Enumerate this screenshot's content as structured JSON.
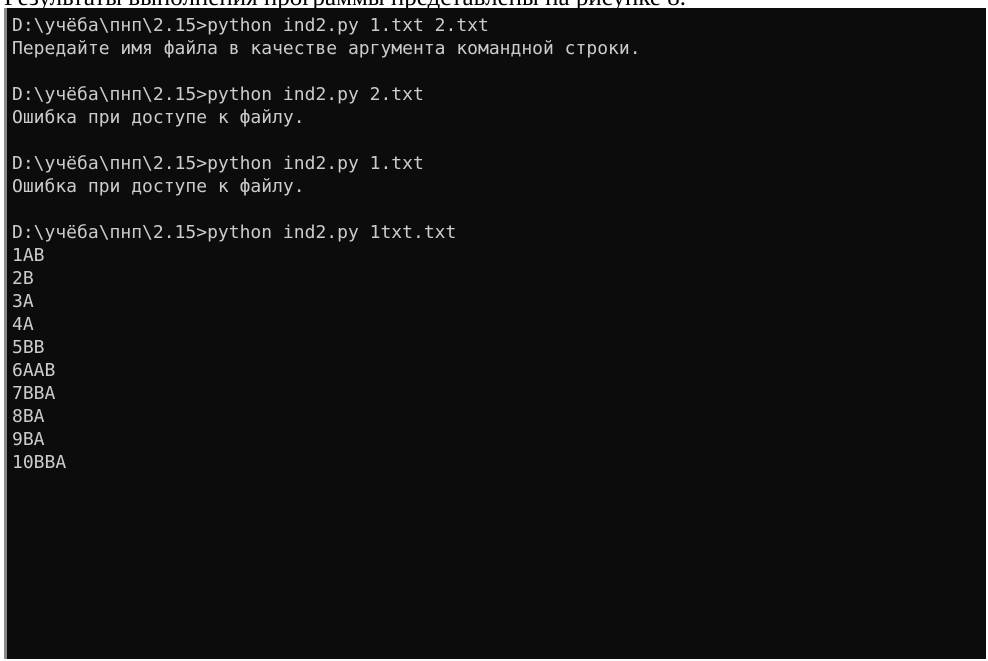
{
  "document": {
    "fragment_text": "Результаты выполнения программы представлены на рисунке 8."
  },
  "terminal": {
    "prompt": "D:\\учёба\\пнп\\2.15>",
    "session": [
      {
        "command": "python ind2.py 1.txt 2.txt",
        "output": [
          "Передайте имя файла в качестве аргумента командной строки."
        ]
      },
      {
        "command": "python ind2.py 2.txt",
        "output": [
          "Ошибка при доступе к файлу."
        ]
      },
      {
        "command": "python ind2.py 1.txt",
        "output": [
          "Ошибка при доступе к файлу."
        ]
      },
      {
        "command": "python ind2.py 1txt.txt",
        "output": [
          "1AB",
          "2B",
          "3A",
          "4A",
          "5BB",
          "6AAB",
          "7BBA",
          "8BA",
          "9BA",
          "10BBA"
        ]
      }
    ]
  }
}
